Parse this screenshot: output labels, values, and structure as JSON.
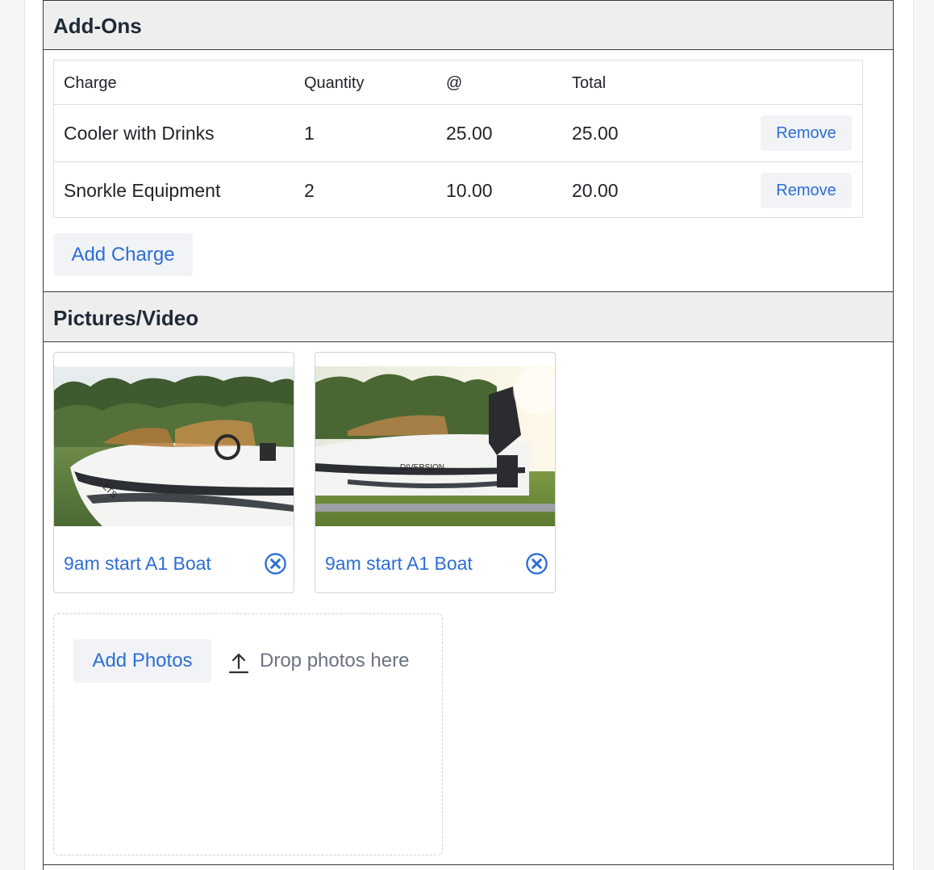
{
  "addons": {
    "title": "Add-Ons",
    "columns": {
      "charge": "Charge",
      "quantity": "Quantity",
      "at": "@",
      "total": "Total"
    },
    "rows": [
      {
        "charge": "Cooler with Drinks",
        "quantity": "1",
        "at": "25.00",
        "total": "25.00",
        "remove_label": "Remove"
      },
      {
        "charge": "Snorkle Equipment",
        "quantity": "2",
        "at": "10.00",
        "total": "20.00",
        "remove_label": "Remove"
      }
    ],
    "add_charge_label": "Add Charge"
  },
  "media": {
    "title": "Pictures/Video",
    "photos": [
      {
        "caption": "9am start A1 Boat",
        "remove_icon": "close-circle-icon"
      },
      {
        "caption": "9am start A1 Boat",
        "remove_icon": "close-circle-icon"
      }
    ],
    "add_photos_label": "Add Photos",
    "drop_text": "Drop photos here",
    "upload_icon": "upload-icon"
  },
  "colors": {
    "accent": "#2c6ed5",
    "header_bg": "#eeeeee",
    "button_bg": "#f1f3f6",
    "muted_text": "#6b7280"
  }
}
